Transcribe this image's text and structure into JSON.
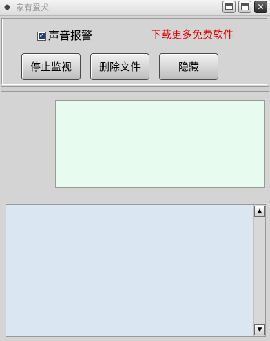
{
  "window": {
    "title": "家有爱犬",
    "icon": "app-icon",
    "controls": {
      "minimize_icon": "minimize-icon",
      "maximize_icon": "maximize-icon",
      "close_icon": "close-icon",
      "close_glyph": "✕"
    }
  },
  "controls": {
    "sound_alarm_label": "声音报警",
    "sound_alarm_checked": true,
    "download_link": "下载更多免费软件",
    "stop_monitor_label": "停止监视",
    "delete_files_label": "删除文件",
    "hide_label": "隐藏"
  },
  "log": {
    "scroll_up_icon": "arrow-up-icon",
    "scroll_down_icon": "arrow-down-icon",
    "up_glyph": "▲",
    "down_glyph": "▼"
  },
  "colors": {
    "link": "#e00000",
    "preview_bg": "#e8fbef",
    "log_bg": "#dbe6f3"
  }
}
